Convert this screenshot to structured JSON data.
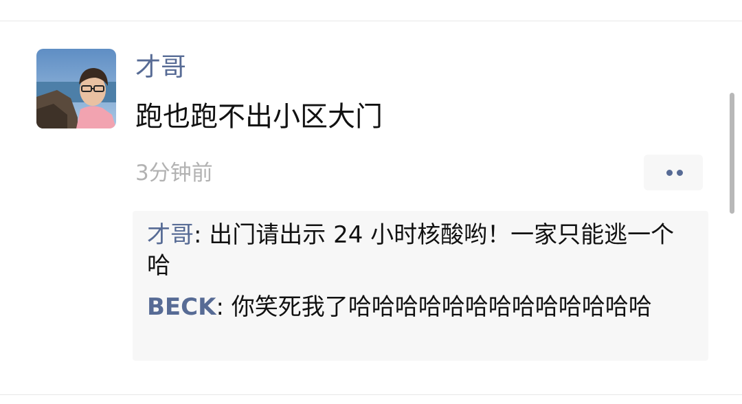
{
  "post": {
    "author": "才哥",
    "text": "跑也跑不出小区大门",
    "time": "3分钟前"
  },
  "comments": [
    {
      "author": "才哥",
      "text": "出门请出示 24 小时核酸哟！一家只能逃一个哈"
    },
    {
      "author": "BECK",
      "text": "你笑死我了哈哈哈哈哈哈哈哈哈哈哈哈哈"
    }
  ],
  "colors": {
    "link_blue": "#576b95",
    "time_gray": "#b2b2b2",
    "comment_bg": "#f7f7f7"
  },
  "icons": {
    "more": "more-dots-icon"
  }
}
